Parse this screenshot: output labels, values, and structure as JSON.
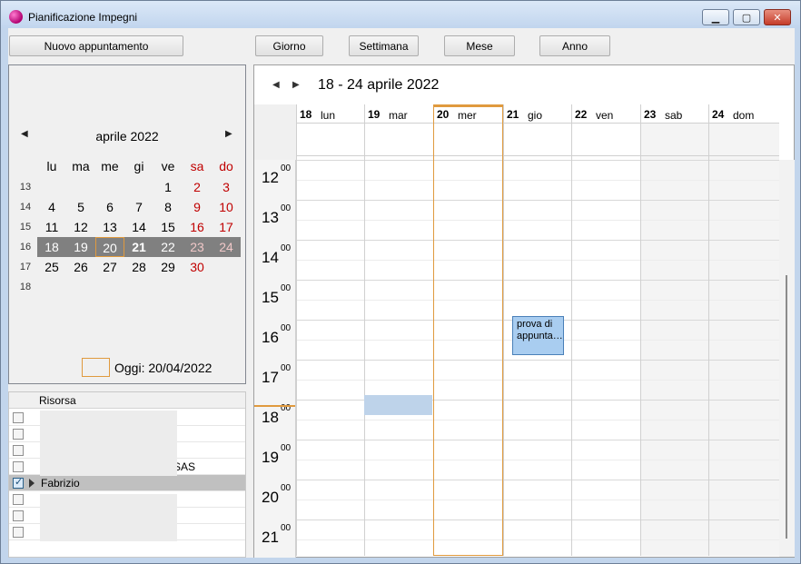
{
  "window": {
    "title": "Pianificazione Impegni"
  },
  "toolbar": {
    "new_label": "Nuovo appuntamento",
    "day_label": "Giorno",
    "week_label": "Settimana",
    "month_label": "Mese",
    "year_label": "Anno"
  },
  "mini_calendar": {
    "month_title": "aprile 2022",
    "weekdays": [
      "lu",
      "ma",
      "me",
      "gi",
      "ve",
      "sa",
      "do"
    ],
    "week_numbers": [
      "13",
      "14",
      "15",
      "16",
      "17",
      "18"
    ],
    "rows": [
      [
        "",
        "",
        "",
        "",
        "1",
        "2",
        "3"
      ],
      [
        "4",
        "5",
        "6",
        "7",
        "8",
        "9",
        "10"
      ],
      [
        "11",
        "12",
        "13",
        "14",
        "15",
        "16",
        "17"
      ],
      [
        "18",
        "19",
        "20",
        "21",
        "22",
        "23",
        "24"
      ],
      [
        "25",
        "26",
        "27",
        "28",
        "29",
        "30",
        ""
      ],
      [
        "",
        "",
        "",
        "",
        "",
        "",
        ""
      ]
    ],
    "today_label": "Oggi: 20/04/2022"
  },
  "resources": {
    "header": "Risorsa",
    "rows": [
      {
        "name": "",
        "checked": false
      },
      {
        "name": "",
        "checked": false
      },
      {
        "name": "",
        "checked": false
      },
      {
        "name": "SAS",
        "checked": false
      },
      {
        "name": "Fabrizio",
        "checked": true
      },
      {
        "name": "",
        "checked": false
      },
      {
        "name": "",
        "checked": false
      },
      {
        "name": "",
        "checked": false
      }
    ]
  },
  "week_view": {
    "range_label": "18 - 24 aprile 2022",
    "days": [
      {
        "num": "18",
        "name": "lun"
      },
      {
        "num": "19",
        "name": "mar"
      },
      {
        "num": "20",
        "name": "mer"
      },
      {
        "num": "21",
        "name": "gio"
      },
      {
        "num": "22",
        "name": "ven"
      },
      {
        "num": "23",
        "name": "sab"
      },
      {
        "num": "24",
        "name": "dom"
      }
    ],
    "hours": [
      "12",
      "13",
      "14",
      "15",
      "16",
      "17",
      "18",
      "19",
      "20",
      "21"
    ],
    "minutes_label": "00",
    "appointment": {
      "text": "prova di appunta…",
      "day": "gio",
      "hour": "16"
    }
  },
  "colors": {
    "accent_today": "#e09a3e",
    "weekend": "#c00000",
    "appointment_bg": "#a9cdf0"
  }
}
